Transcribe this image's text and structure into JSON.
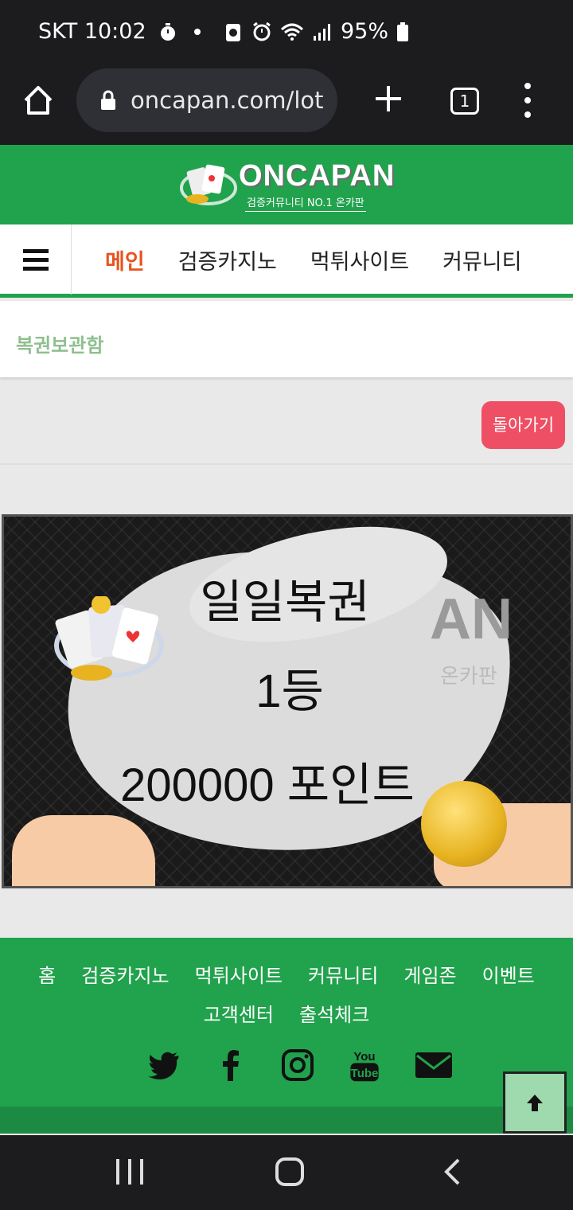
{
  "status_bar": {
    "carrier_time": "SKT 10:02",
    "battery": "95%"
  },
  "browser": {
    "url": "oncapan.com/lot",
    "tab_count": "1"
  },
  "site": {
    "logo_name": "ONCAPAN",
    "logo_tagline": "검증커뮤니티 NO.1 온카판"
  },
  "nav": {
    "items": [
      "메인",
      "검증카지노",
      "먹튀사이트",
      "커뮤니티"
    ]
  },
  "page": {
    "section_title": "복권보관함",
    "back_button": "돌아가기"
  },
  "lottery": {
    "title": "일일복권",
    "rank": "1등",
    "prize": "200000 포인트"
  },
  "footer": {
    "links": [
      "홈",
      "검증카지노",
      "먹튀사이트",
      "커뮤니티",
      "게임존",
      "이벤트",
      "고객센터",
      "출석체크"
    ]
  },
  "colors": {
    "brand_green": "#21a24d",
    "active_nav": "#e8531e",
    "back_button": "#ef4f64"
  }
}
